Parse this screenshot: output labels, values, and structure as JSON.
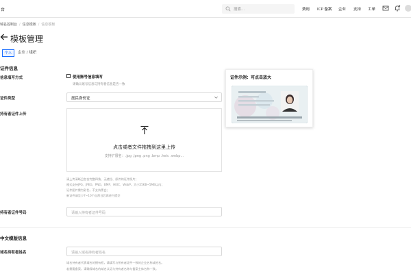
{
  "topbar": {
    "console": "台",
    "search_placeholder": "搜索...",
    "nav": [
      "费用",
      "ICP 备案",
      "企业",
      "支持",
      "工单"
    ]
  },
  "breadcrumb": [
    "域名控制台",
    "信息模板",
    "信息模板"
  ],
  "page": {
    "title": "模板管理"
  },
  "tabs": {
    "individual": "个人",
    "enterprise": "企业 / 组织"
  },
  "form": {
    "cert_section": "证件信息",
    "fill_method_label": "信息填写方式",
    "use_account_checkbox": "使用账号信息填写",
    "use_account_help": "请确认账号信息与持有者信息是否一致",
    "cert_type_label": "证件类型",
    "cert_type_value": "居民身份证",
    "upload_label": "持有者证件上传",
    "upload_main": "点击或者文件拖拽到这里上传",
    "upload_sub": "支持扩展名：.jpg .jpeg .png .bmp .heic .webp...",
    "requirements": [
      "请上传清晰且包含完整四角、无遮挡、原件的证件照片；",
      "格式支持JPG、JPEG、PNG、BMP、HEIC、WebP，大小55KB~5MB以内；",
      "证件图片需为彩色，不支持黑白；",
      "新证件请至少7~10个自然日后再进行提交"
    ],
    "cert_number_label": "持有者证件号码",
    "cert_number_placeholder": "请输入持有者证件号码",
    "cn_section": "中文模版信息",
    "owner_name_label": "域名持有者姓名",
    "owner_name_placeholder": "请输入域名持有者姓名",
    "owner_name_notes": [
      "域名持有者代表域名的拥有权，请填写与所有者证件一致的企业名称或姓名。",
      "若需要备案，请确保域名的域名认证与持有者名称与备案主体名称一致。"
    ]
  },
  "example": {
    "title": "证件示例：可点击放大"
  },
  "colors": {
    "accent": "#1a6eff",
    "border": "#d9d9d9",
    "muted": "#999999"
  },
  "icons": [
    "search-icon",
    "mail-icon",
    "bell-icon",
    "chevron-down-icon",
    "upload-icon",
    "arrow-left-icon"
  ]
}
